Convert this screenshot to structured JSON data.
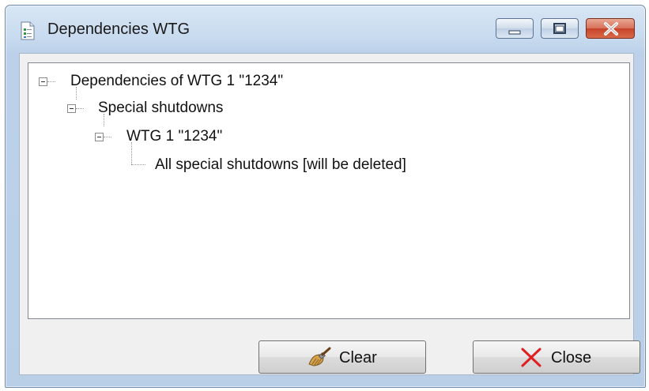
{
  "window": {
    "title": "Dependencies WTG",
    "icon": "document-check-icon"
  },
  "controls": {
    "minimize": "minimize-icon",
    "maximize": "maximize-icon",
    "close": "close-icon"
  },
  "tree": {
    "nodes": [
      {
        "label": "Dependencies of WTG 1 \"1234\"",
        "level": 0,
        "expanded": true
      },
      {
        "label": "Special shutdowns",
        "level": 1,
        "expanded": true
      },
      {
        "label": "WTG 1 \"1234\"",
        "level": 2,
        "expanded": true
      },
      {
        "label": "All special shutdowns [will be deleted]",
        "level": 3,
        "expanded": false
      }
    ]
  },
  "buttons": {
    "clear": {
      "label": "Clear",
      "icon": "broom-icon"
    },
    "close": {
      "label": "Close",
      "icon": "red-x-icon"
    }
  },
  "colors": {
    "close_x": "#e02020",
    "titlebar_close": "#c6432a"
  }
}
